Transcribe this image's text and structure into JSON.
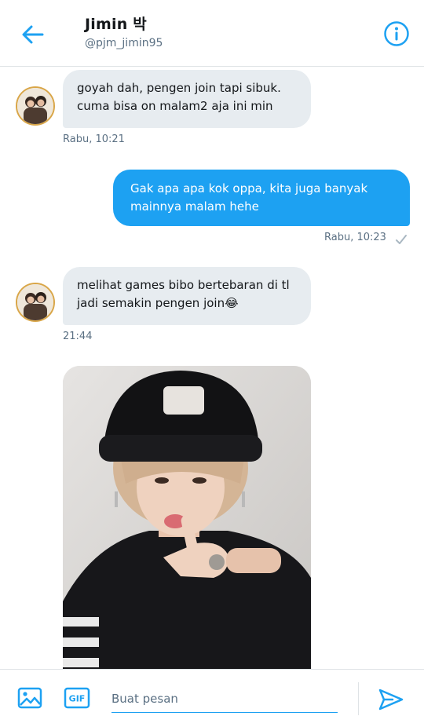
{
  "header": {
    "title": "Jimin 박",
    "handle": "@pjm_jimin95"
  },
  "messages": [
    {
      "direction": "in",
      "lines": [
        "goyah dah, pengen join tapi sibuk.",
        "cuma bisa on malam2 aja ini min"
      ],
      "time": "Rabu, 10:21"
    },
    {
      "direction": "out",
      "lines": [
        "Gak apa apa kok oppa, kita juga banyak",
        "mainnya malam hehe"
      ],
      "time": "Rabu, 10:23"
    },
    {
      "direction": "in",
      "lines": [
        "melihat games bibo bertebaran di tl",
        "jadi semakin pengen join😂"
      ],
      "time": "21:44"
    }
  ],
  "composer": {
    "placeholder": "Buat pesan",
    "gif_label": "GIF"
  },
  "colors": {
    "accent": "#1da1f2",
    "incoming_bubble": "#e7ecf0",
    "secondary_text": "#5b7083"
  },
  "icons": [
    "back-arrow-icon",
    "info-icon",
    "image-icon",
    "gif-icon",
    "send-icon",
    "read-check-icon"
  ]
}
